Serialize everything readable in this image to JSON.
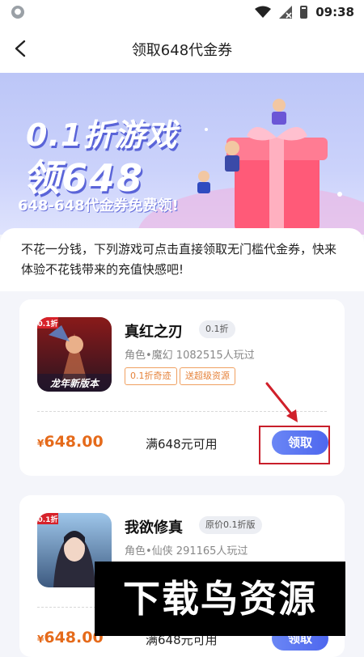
{
  "status_bar": {
    "time": "09:38"
  },
  "nav": {
    "title": "领取648代金券"
  },
  "banner": {
    "line1": "0.1折游戏",
    "line2": "领648",
    "line3": "648-648代金券免费领!"
  },
  "intro": {
    "text": "不花一分钱，下列游戏可点击直接领取无门槛代金券，快来体验不花钱带来的充值快感吧!"
  },
  "games": [
    {
      "title": "真红之刃",
      "badge": "0.1折",
      "meta": "角色•魔幻  1082515人玩过",
      "tags": [
        "0.1折奇迹",
        "送超级资源"
      ],
      "icon_label": "龙年新版本",
      "icon_corner": "0.1折",
      "price_symbol": "¥",
      "price": "648.00",
      "condition": "满648元可用",
      "claim_label": "领取"
    },
    {
      "title": "我欲修真",
      "badge": "原价0.1折版",
      "meta": "角色•仙侠  291165人玩过",
      "tags": [],
      "icon_corner": "0.1折",
      "price_symbol": "¥",
      "price": "648.00",
      "condition": "满648元可用",
      "claim_label": "领取"
    }
  ],
  "watermark": {
    "text": "下载鸟资源"
  },
  "colors": {
    "accent": "#4e67ee",
    "price": "#e56a1a",
    "highlight": "#c81e2a"
  }
}
